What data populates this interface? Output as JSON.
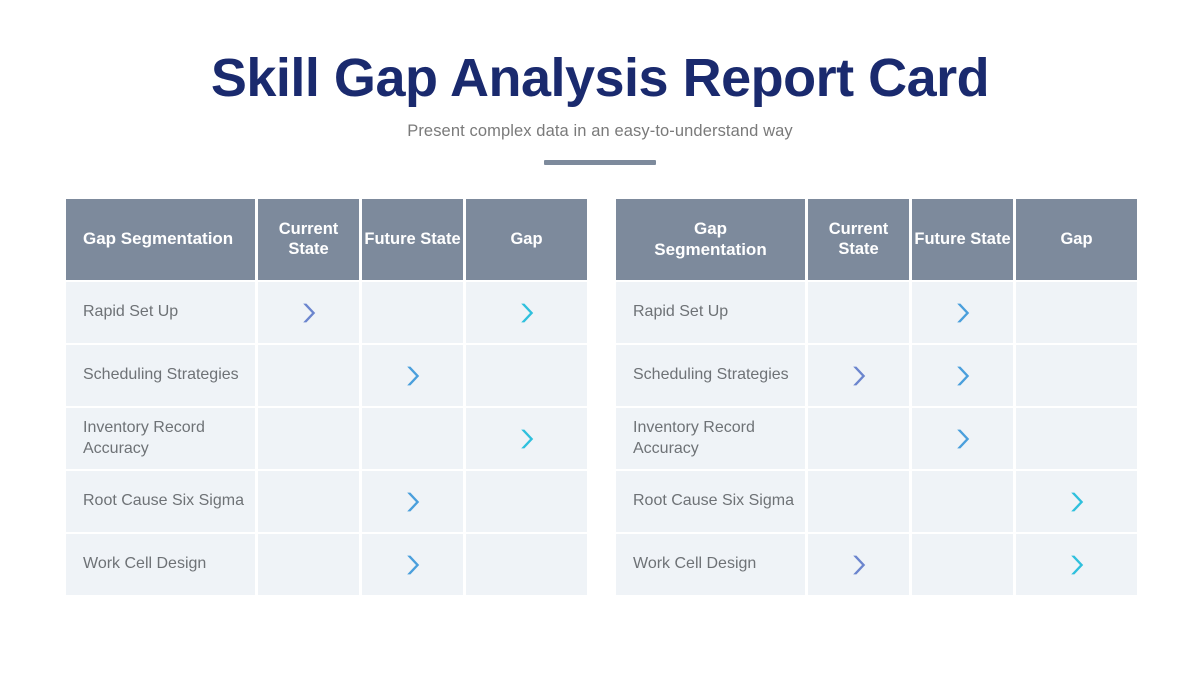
{
  "header": {
    "title": "Skill Gap Analysis Report Card",
    "subtitle": "Present complex data in an easy-to-understand way"
  },
  "colors": {
    "title": "#1a2a6e",
    "subtitle": "#7a7a7a",
    "header_cell_bg": "#7d8a9c",
    "body_cell_bg": "#eff3f7",
    "row_label": "#6e7276",
    "chevron_periwinkle": "#6b85ce",
    "chevron_blue": "#4a9fdc",
    "chevron_cyan": "#2fc0dd"
  },
  "tables": [
    {
      "id": "left-table",
      "columns": [
        "Gap Segmentation",
        "Current State",
        "Future State",
        "Gap"
      ],
      "rows": [
        {
          "label": "Rapid Set Up",
          "current": "periwinkle",
          "future": "",
          "gap": "cyan"
        },
        {
          "label": "Scheduling Strategies",
          "current": "",
          "future": "blue",
          "gap": ""
        },
        {
          "label": "Inventory Record Accuracy",
          "current": "",
          "future": "",
          "gap": "cyan"
        },
        {
          "label": "Root Cause Six Sigma",
          "current": "",
          "future": "blue",
          "gap": ""
        },
        {
          "label": "Work Cell Design",
          "current": "",
          "future": "blue",
          "gap": ""
        }
      ]
    },
    {
      "id": "right-table",
      "columns": [
        "Gap Segmentation",
        "Current State",
        "Future State",
        "Gap"
      ],
      "rows": [
        {
          "label": "Rapid Set Up",
          "current": "",
          "future": "blue",
          "gap": ""
        },
        {
          "label": "Scheduling Strategies",
          "current": "periwinkle",
          "future": "blue",
          "gap": ""
        },
        {
          "label": "Inventory Record Accuracy",
          "current": "",
          "future": "blue",
          "gap": ""
        },
        {
          "label": "Root Cause Six Sigma",
          "current": "",
          "future": "",
          "gap": "cyan"
        },
        {
          "label": "Work Cell Design",
          "current": "periwinkle",
          "future": "",
          "gap": "cyan"
        }
      ]
    }
  ]
}
